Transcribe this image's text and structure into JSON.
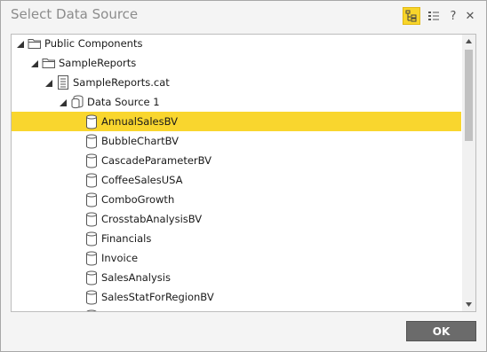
{
  "dialog": {
    "title": "Select Data Source",
    "help_label": "?",
    "close_label": "✕",
    "ok_label": "OK"
  },
  "tree": {
    "items": [
      {
        "label": "Public Components",
        "level": 0,
        "kind": "folder",
        "expanded": true
      },
      {
        "label": "SampleReports",
        "level": 1,
        "kind": "folder",
        "expanded": true
      },
      {
        "label": "SampleReports.cat",
        "level": 2,
        "kind": "catalog",
        "expanded": true
      },
      {
        "label": "Data Source 1",
        "level": 3,
        "kind": "datasource",
        "expanded": true
      },
      {
        "label": "AnnualSalesBV",
        "level": 4,
        "kind": "database",
        "selected": true
      },
      {
        "label": "BubbleChartBV",
        "level": 4,
        "kind": "database"
      },
      {
        "label": "CascadeParameterBV",
        "level": 4,
        "kind": "database"
      },
      {
        "label": "CoffeeSalesUSA",
        "level": 4,
        "kind": "database"
      },
      {
        "label": "ComboGrowth",
        "level": 4,
        "kind": "database"
      },
      {
        "label": "CrosstabAnalysisBV",
        "level": 4,
        "kind": "database"
      },
      {
        "label": "Financials",
        "level": 4,
        "kind": "database"
      },
      {
        "label": "Invoice",
        "level": 4,
        "kind": "database"
      },
      {
        "label": "SalesAnalysis",
        "level": 4,
        "kind": "database"
      },
      {
        "label": "SalesStatForRegionBV",
        "level": 4,
        "kind": "database"
      },
      {
        "label": "",
        "level": 4,
        "kind": "database"
      }
    ]
  },
  "colors": {
    "selection": "#f9d62e",
    "ok_button": "#6b6b6b",
    "active_toggle": "#f8d52a"
  }
}
